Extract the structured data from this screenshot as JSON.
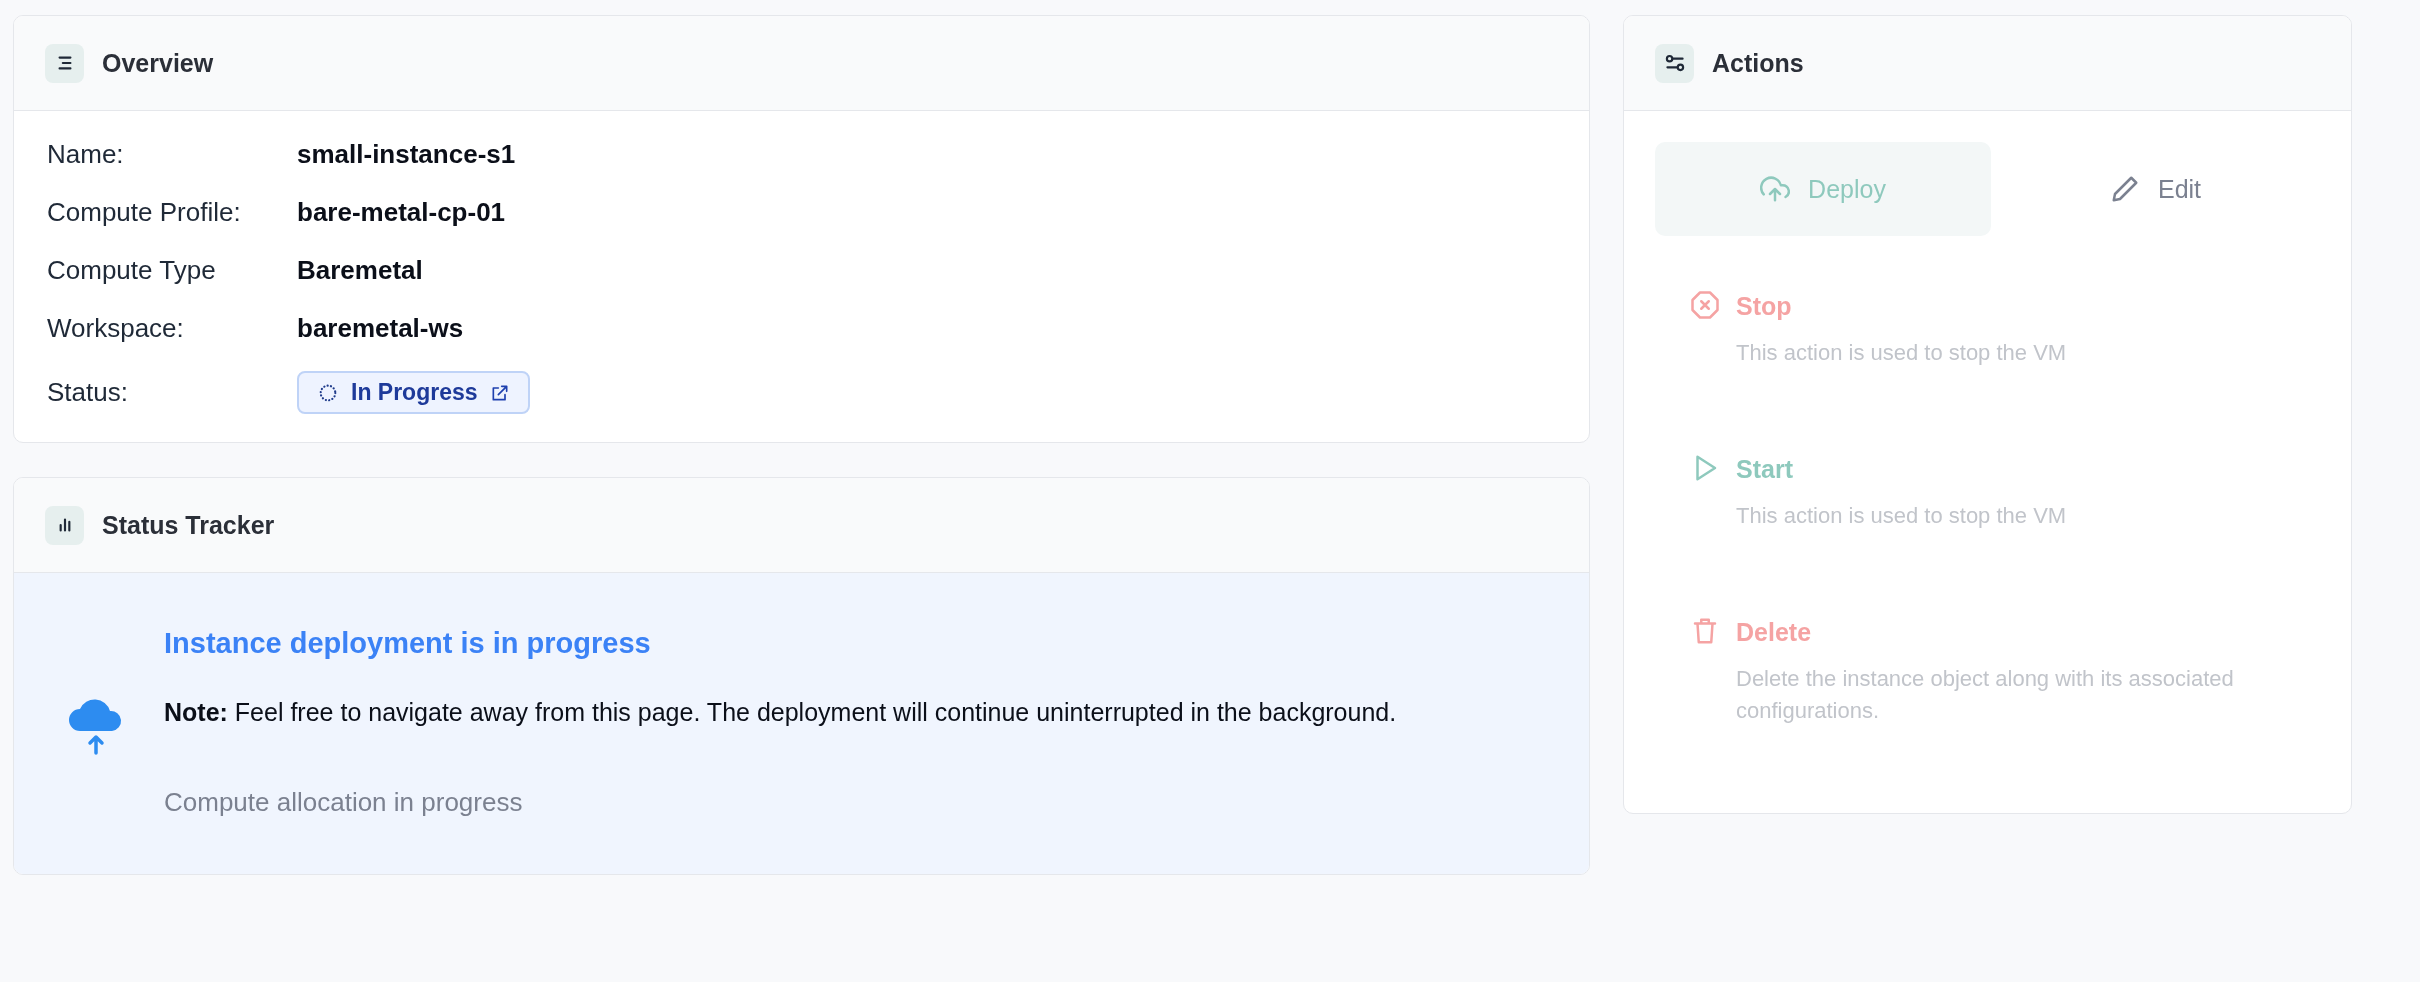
{
  "overview": {
    "title": "Overview",
    "fields": [
      {
        "label": "Name:",
        "value": "small-instance-s1"
      },
      {
        "label": "Compute Profile:",
        "value": "bare-metal-cp-01"
      },
      {
        "label": "Compute Type",
        "value": "Baremetal"
      },
      {
        "label": "Workspace:",
        "value": "baremetal-ws"
      },
      {
        "label": "Status:",
        "value": "In Progress",
        "kind": "status"
      }
    ]
  },
  "status_tracker": {
    "title": "Status Tracker",
    "heading": "Instance deployment is in progress",
    "note": "**Note:** Feel free to navigate away from this page. The deployment will continue uninterrupted in the background.",
    "step": "Compute allocation in progress"
  },
  "actions": {
    "title": "Actions",
    "buttons": [
      {
        "label": "Deploy",
        "kind": "deploy",
        "selected": true
      },
      {
        "label": "Edit",
        "kind": "edit",
        "selected": false
      }
    ],
    "items": [
      {
        "kind": "stop",
        "label": "Stop",
        "description": "This action is used to stop the VM",
        "color": "#f5a3a3"
      },
      {
        "kind": "start",
        "label": "Start",
        "description": "This action is used to stop the VM",
        "color": "#8ec9bd"
      },
      {
        "kind": "delete",
        "label": "Delete",
        "description": "Delete the instance object along with its associated configurations.",
        "color": "#f5a3a3"
      }
    ]
  }
}
